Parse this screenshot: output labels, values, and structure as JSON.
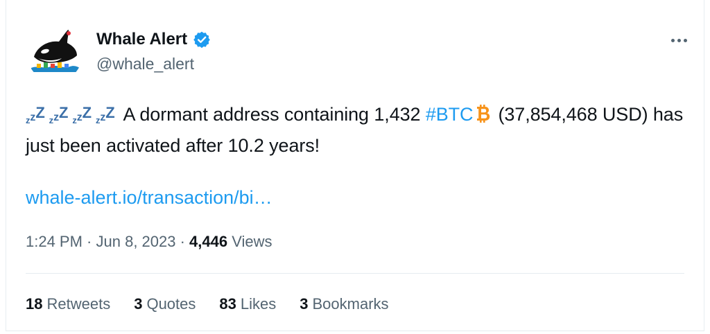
{
  "author": {
    "display_name": "Whale Alert",
    "handle": "@whale_alert",
    "avatar_icon": "orca-whale-logo",
    "verified_icon": "verified-badge-icon",
    "verified_color": "#1d9bf0"
  },
  "tweet": {
    "zzz_icons": [
      "zzz-sleep-icon",
      "zzz-sleep-icon",
      "zzz-sleep-icon",
      "zzz-sleep-icon"
    ],
    "text_before": "A dormant address containing 1,432 ",
    "hashtag": "#BTC",
    "coin_icon": "bitcoin-icon",
    "text_after": "(37,854,468 USD) has just been activated after 10.2 years!",
    "link": "whale-alert.io/transaction/bi…"
  },
  "meta": {
    "time": "1:24 PM",
    "separator": " · ",
    "date": "Jun 8, 2023",
    "views_count": "4,446",
    "views_label": "Views"
  },
  "stats": [
    {
      "count": "18",
      "label": "Retweets"
    },
    {
      "count": "3",
      "label": "Quotes"
    },
    {
      "count": "83",
      "label": "Likes"
    },
    {
      "count": "3",
      "label": "Bookmarks"
    }
  ],
  "colors": {
    "link_blue": "#1d9bf0",
    "secondary_text": "#536471",
    "primary_text": "#0f1419",
    "bitcoin_orange": "#f7931a"
  }
}
